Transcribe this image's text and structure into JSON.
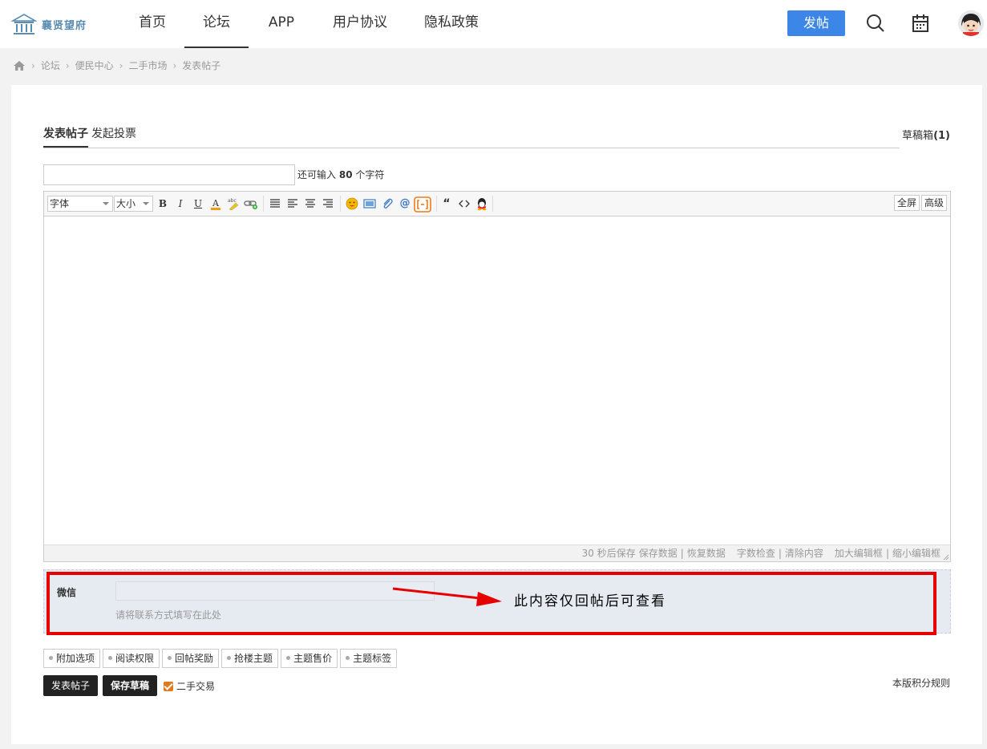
{
  "logo": {
    "text": "襄贤望府"
  },
  "nav": {
    "items": [
      {
        "label": "首页"
      },
      {
        "label": "论坛"
      },
      {
        "label": "APP"
      },
      {
        "label": "用户协议"
      },
      {
        "label": "隐私政策"
      }
    ],
    "active": "论坛",
    "post_button": "发帖",
    "accent_color": "#3b86e6"
  },
  "breadcrumb": [
    "论坛",
    "便民中心",
    "二手市场",
    "发表帖子"
  ],
  "compose": {
    "tabs": [
      "发表帖子",
      "发起投票"
    ],
    "drafts_label": "草稿箱",
    "drafts_count": "(1)",
    "title_value": "",
    "char_hint_prefix": "还可输入",
    "char_hint_count": "80",
    "char_hint_suffix": "个字符"
  },
  "editor": {
    "font_select": "字体",
    "size_select": "大小",
    "toolbar_right": [
      "全屏",
      "高级"
    ],
    "body_value": "",
    "status": {
      "autosave": "30 秒后保存",
      "save": "保存数据",
      "restore": "恢复数据",
      "word_check": "字数检查",
      "clear": "清除内容",
      "enlarge": "加大编辑框",
      "shrink": "缩小编辑框",
      "sep": "|"
    }
  },
  "wechat": {
    "label": "微信",
    "value": "",
    "hint": "请将联系方式填写在此处"
  },
  "annotation": {
    "text": "此内容仅回帖后可查看",
    "color": "#e60000"
  },
  "options": [
    "附加选项",
    "阅读权限",
    "回帖奖励",
    "抢楼主题",
    "主题售价",
    "主题标签"
  ],
  "actions": {
    "submit": "发表帖子",
    "save_draft": "保存草稿",
    "checkbox_label": "二手交易",
    "checkbox_checked": true,
    "rules_link": "本版积分规则"
  }
}
